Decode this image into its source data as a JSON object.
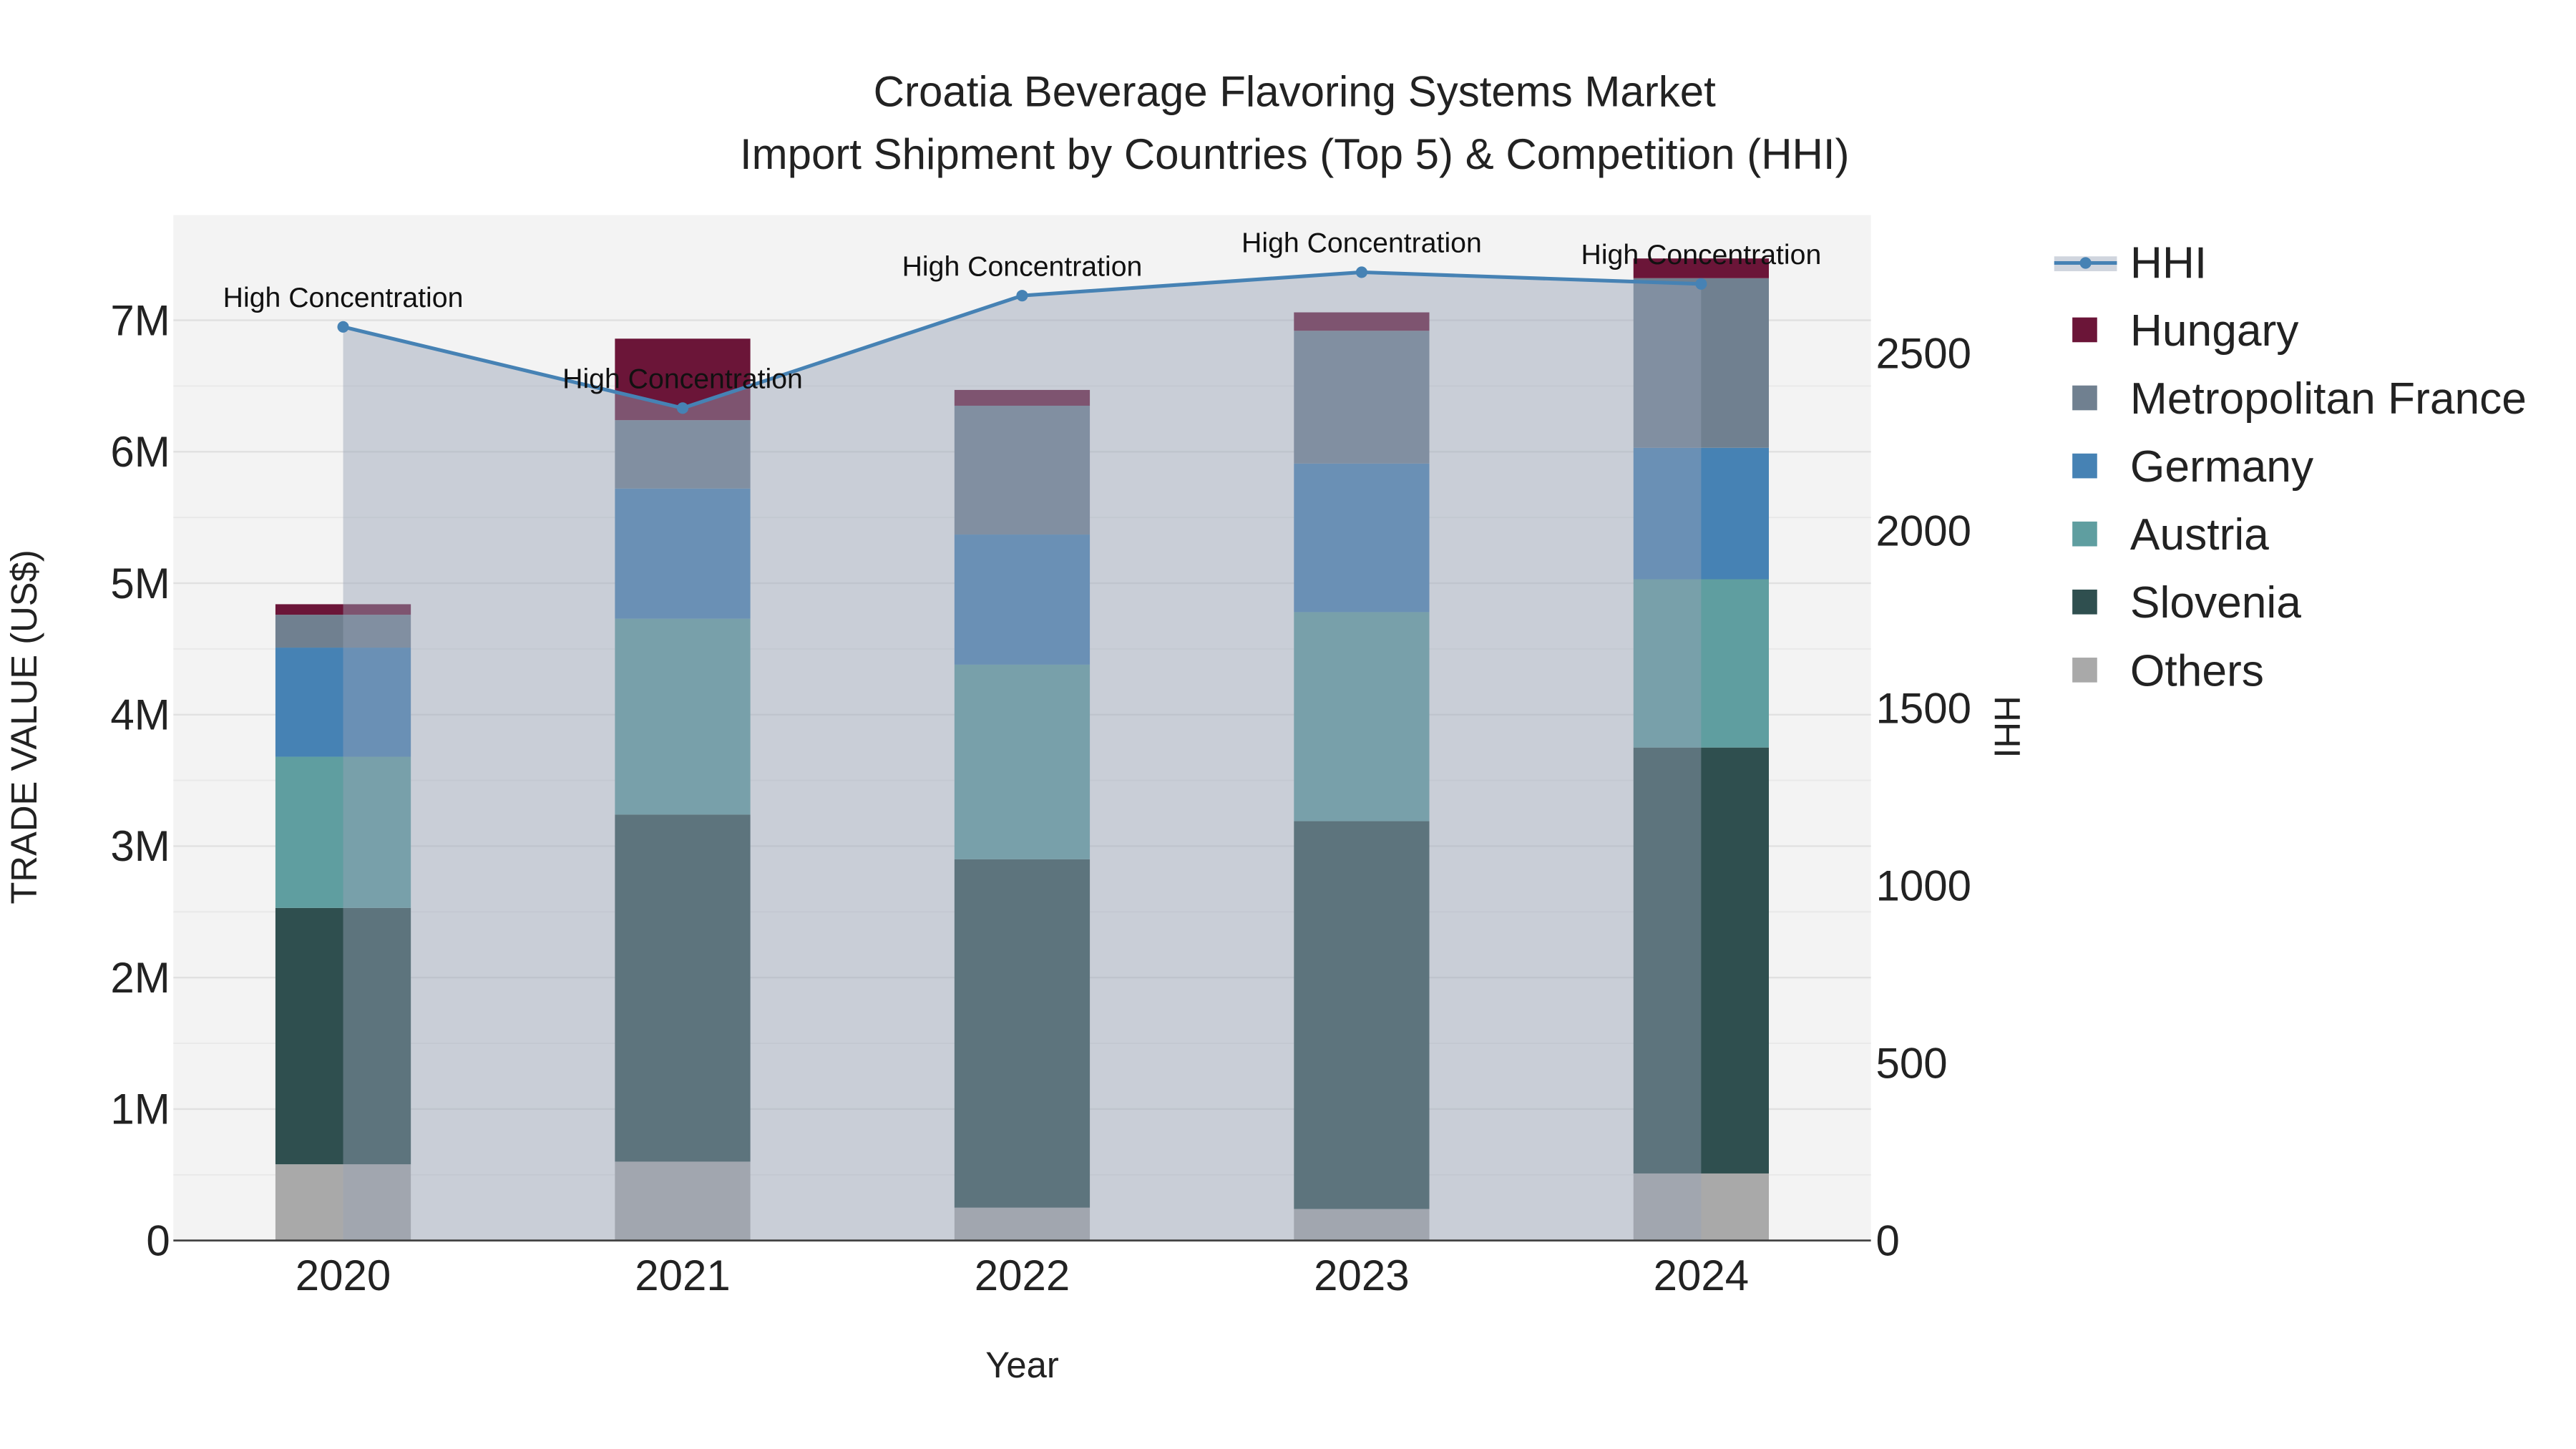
{
  "chart_data": {
    "type": "bar",
    "title": "Croatia Beverage Flavoring Systems Market",
    "subtitle": "Import Shipment by Countries (Top 5) & Competition (HHI)",
    "xlabel": "Year",
    "ylabel": "TRADE VALUE (US$)",
    "y2label": "HHI",
    "categories": [
      "2020",
      "2021",
      "2022",
      "2023",
      "2024"
    ],
    "ylim": [
      0,
      7800000
    ],
    "y2lim": [
      0,
      2890
    ],
    "yticks": [
      0,
      1000000,
      2000000,
      3000000,
      4000000,
      5000000,
      6000000,
      7000000
    ],
    "ytick_labels": [
      "0",
      "1M",
      "2M",
      "3M",
      "4M",
      "5M",
      "6M",
      "7M"
    ],
    "y2ticks": [
      0,
      500,
      1000,
      1500,
      2000,
      2500
    ],
    "y2tick_labels": [
      "0",
      "500",
      "1000",
      "1500",
      "2000",
      "2500"
    ],
    "stacked": true,
    "series": [
      {
        "name": "Others",
        "color": "#a9a9a9",
        "values": [
          580000,
          600000,
          250000,
          240000,
          510000
        ]
      },
      {
        "name": "Slovenia",
        "color": "#2f4f4f",
        "values": [
          1950000,
          2640000,
          2650000,
          2950000,
          3240000
        ]
      },
      {
        "name": "Austria",
        "color": "#5f9ea0",
        "values": [
          1150000,
          1490000,
          1480000,
          1590000,
          1280000
        ]
      },
      {
        "name": "Germany",
        "color": "#4682b4",
        "values": [
          830000,
          990000,
          990000,
          1130000,
          1000000
        ]
      },
      {
        "name": "Metropolitan France",
        "color": "#708090",
        "values": [
          250000,
          520000,
          980000,
          1010000,
          1290000
        ]
      },
      {
        "name": "Hungary",
        "color": "#6b1538",
        "values": [
          80000,
          620000,
          120000,
          140000,
          150000
        ]
      }
    ],
    "line": {
      "name": "HHI",
      "color": "#4682b4",
      "values": [
        2575,
        2346,
        2663,
        2729,
        2696
      ],
      "annotations": [
        "High Concentration",
        "High Concentration",
        "High Concentration",
        "High Concentration",
        "High Concentration"
      ]
    },
    "legend": [
      "HHI",
      "Hungary",
      "Metropolitan France",
      "Germany",
      "Austria",
      "Slovenia",
      "Others"
    ],
    "legend_position": "right",
    "grid": true
  }
}
